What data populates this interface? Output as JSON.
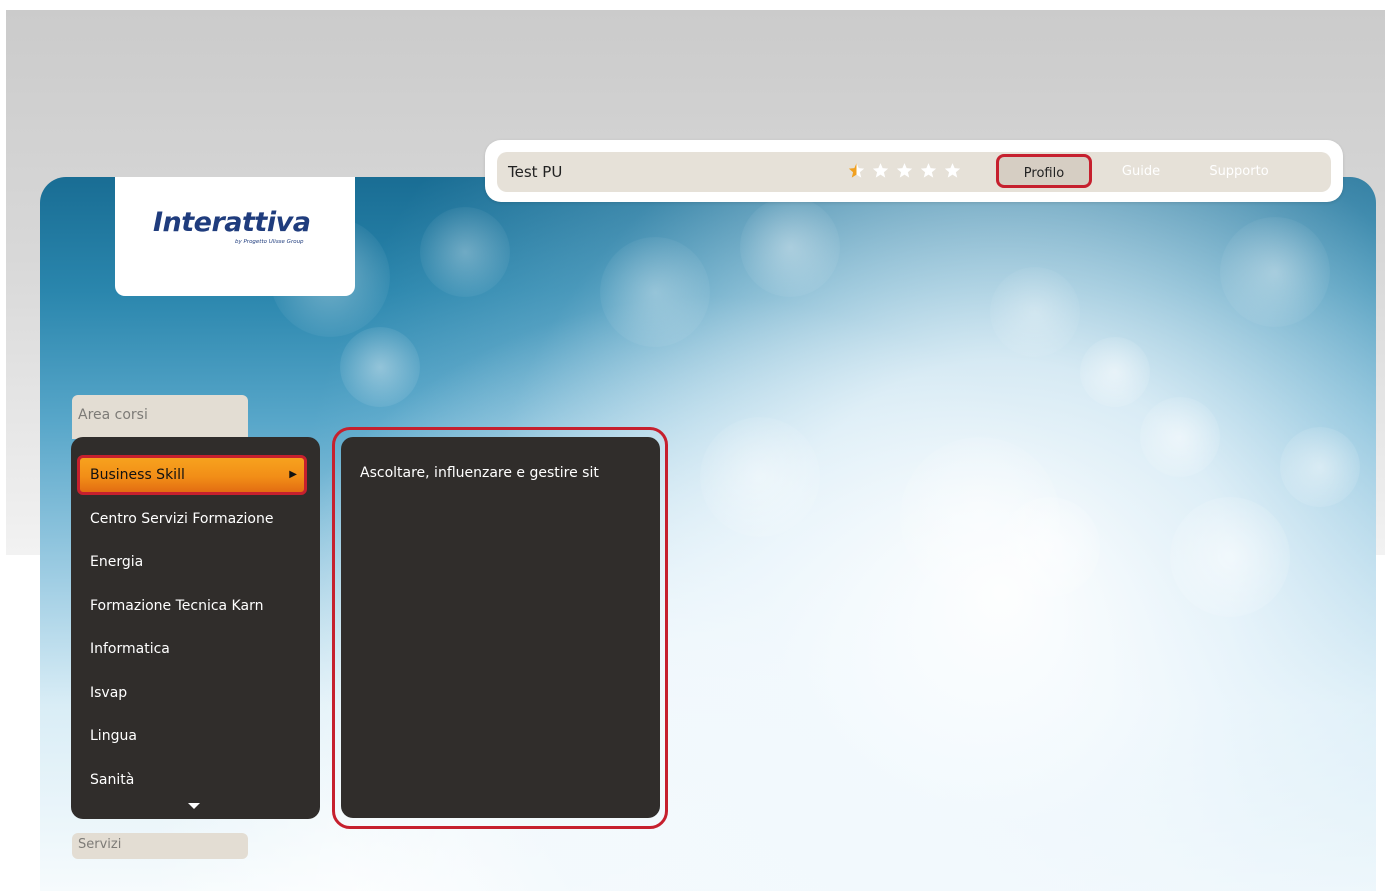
{
  "header": {
    "user_name": "Test PU",
    "rating": {
      "value": 0.5,
      "max": 5
    },
    "nav": {
      "profile": "Profilo",
      "guides": "Guide",
      "support": "Supporto"
    }
  },
  "logo": {
    "brand": "Interattiva",
    "tagline": "by Progetto Ulisse Group"
  },
  "sidebar": {
    "courses_tab": "Area corsi",
    "services_tab": "Servizi",
    "categories": [
      {
        "label": "Business Skill",
        "active": true
      },
      {
        "label": "Centro Servizi Formazione",
        "active": false
      },
      {
        "label": "Energia",
        "active": false
      },
      {
        "label": "Formazione Tecnica Karn",
        "active": false
      },
      {
        "label": "Informatica",
        "active": false
      },
      {
        "label": "Isvap",
        "active": false
      },
      {
        "label": "Lingua",
        "active": false
      },
      {
        "label": "Sanità",
        "active": false
      }
    ]
  },
  "submenu": {
    "items": [
      "Ascoltare, influenzare e gestire sit"
    ]
  },
  "colors": {
    "menu_background": "#302d2b",
    "active_item": "#f28e17",
    "highlight_border": "#c6202e",
    "topbar": "#e6e1d8",
    "brand": "#1f3c7d"
  }
}
